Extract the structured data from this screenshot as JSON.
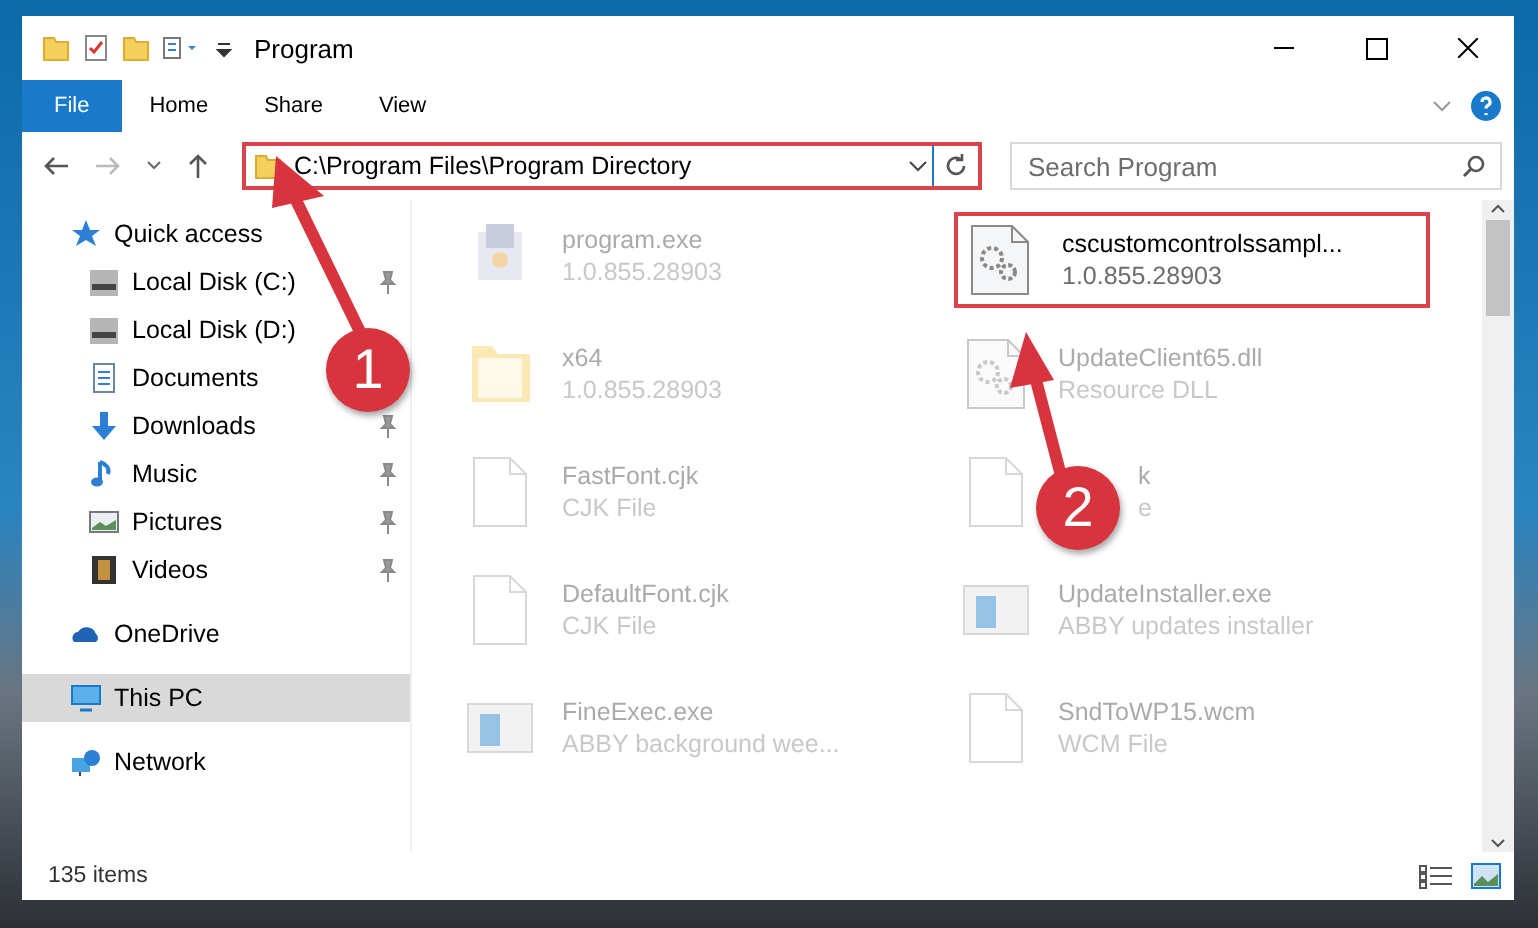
{
  "window": {
    "title": "Program"
  },
  "ribbon_tabs": [
    {
      "label": "File",
      "selected": true
    },
    {
      "label": "Home",
      "selected": false
    },
    {
      "label": "Share",
      "selected": false
    },
    {
      "label": "View",
      "selected": false
    }
  ],
  "address_bar": {
    "path": "C:\\Program Files\\Program Directory"
  },
  "search": {
    "placeholder": "Search Program"
  },
  "sidebar": {
    "items": [
      {
        "label": "Quick access",
        "kind": "quick",
        "pinned": false,
        "selected": false,
        "children": [
          {
            "label": "Local Disk (C:)",
            "kind": "disk",
            "pinned": true,
            "selected": false
          },
          {
            "label": "Local Disk (D:)",
            "kind": "disk",
            "pinned": false,
            "selected": false
          },
          {
            "label": "Documents",
            "kind": "documents",
            "pinned": false,
            "selected": false
          },
          {
            "label": "Downloads",
            "kind": "downloads",
            "pinned": true,
            "selected": false
          },
          {
            "label": "Music",
            "kind": "music",
            "pinned": true,
            "selected": false
          },
          {
            "label": "Pictures",
            "kind": "pictures",
            "pinned": true,
            "selected": false
          },
          {
            "label": "Videos",
            "kind": "videos",
            "pinned": true,
            "selected": false
          }
        ]
      },
      {
        "label": "OneDrive",
        "kind": "cloud",
        "pinned": false,
        "selected": false
      },
      {
        "label": "This PC",
        "kind": "pc",
        "pinned": false,
        "selected": true
      },
      {
        "label": "Network",
        "kind": "network",
        "pinned": false,
        "selected": false
      }
    ]
  },
  "files": [
    {
      "name": "program.exe",
      "detail": "1.0.855.28903",
      "kind": "app",
      "selected": false
    },
    {
      "name": "cscustomcontrolssampl...",
      "detail": "1.0.855.28903",
      "kind": "gear",
      "selected": true
    },
    {
      "name": "x64",
      "detail": "1.0.855.28903",
      "kind": "folder",
      "selected": false
    },
    {
      "name": "UpdateClient65.dll",
      "detail": "Resource DLL",
      "kind": "gear",
      "selected": false
    },
    {
      "name": "FastFont.cjk",
      "detail": "CJK File",
      "kind": "doc",
      "selected": false
    },
    {
      "name": "k",
      "detail": "e",
      "kind": "doc",
      "selected": false
    },
    {
      "name": "DefaultFont.cjk",
      "detail": "CJK File",
      "kind": "doc",
      "selected": false
    },
    {
      "name": "UpdateInstaller.exe",
      "detail": "ABBY updates installer",
      "kind": "window",
      "selected": false
    },
    {
      "name": "FineExec.exe",
      "detail": "ABBY background wee...",
      "kind": "window",
      "selected": false
    },
    {
      "name": "SndToWP15.wcm",
      "detail": "WCM File",
      "kind": "doc",
      "selected": false
    }
  ],
  "status_bar": {
    "item_count": "135 items"
  },
  "annotations": [
    {
      "label": "1"
    },
    {
      "label": "2"
    }
  ]
}
